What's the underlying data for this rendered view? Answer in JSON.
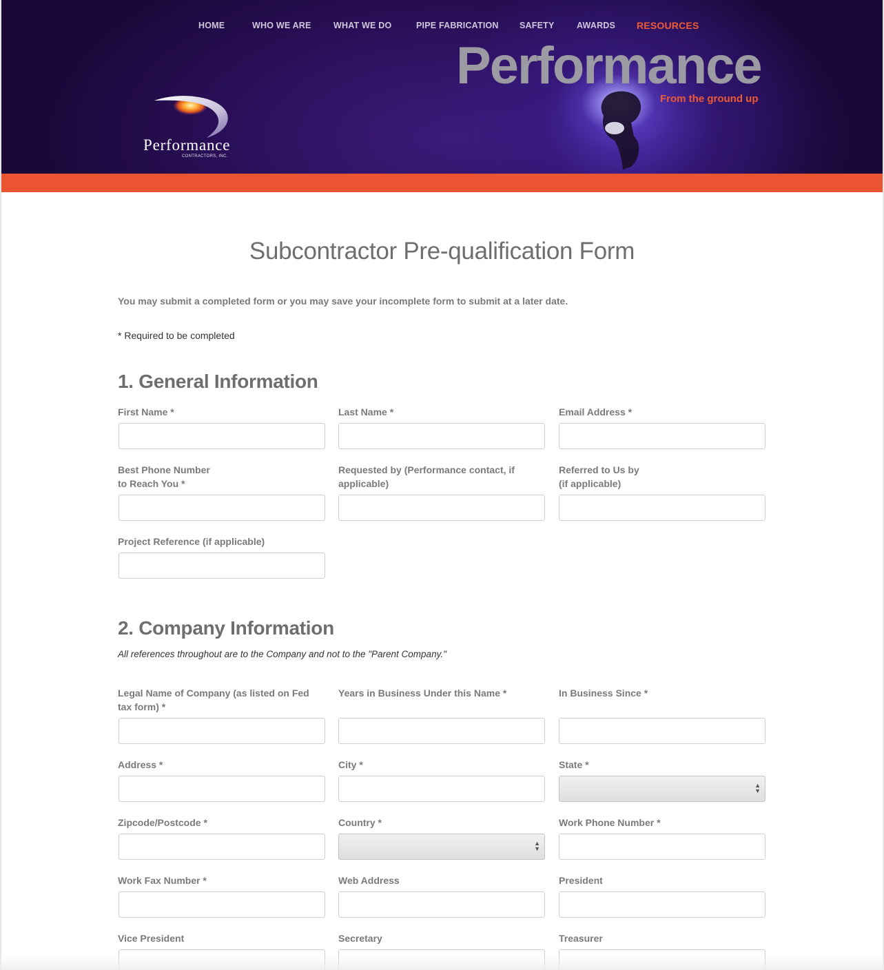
{
  "nav": {
    "items": [
      {
        "label": "HOME"
      },
      {
        "label": "WHO WE ARE"
      },
      {
        "label": "WHAT WE DO"
      },
      {
        "label": "PIPE FABRICATION"
      },
      {
        "label": "SAFETY"
      },
      {
        "label": "AWARDS"
      },
      {
        "label": "RESOURCES"
      }
    ],
    "active_color": "#ef5a32"
  },
  "header": {
    "hero_word": "Performance",
    "hero_tagline": "From the ground up",
    "logo_word": "Performance",
    "logo_sub": "CONTRACTORS, INC.",
    "accent_color": "#ea5430"
  },
  "page": {
    "title": "Subcontractor Pre-qualification Form",
    "intro": "You may submit a completed form or you may save your incomplete form to submit at a later date.",
    "required_note": "* Required to be completed"
  },
  "sections": {
    "general": {
      "title": "1. General Information",
      "fields": {
        "first_name": "First Name *",
        "last_name": "Last Name *",
        "email": "Email Address *",
        "phone_line1": "Best Phone Number",
        "phone_line2": "to Reach You *",
        "requested_by": "Requested by (Performance contact, if applicable)",
        "referred_line1": "Referred to Us by",
        "referred_line2": "(if applicable)",
        "project_reference": "Project Reference (if applicable)"
      }
    },
    "company": {
      "title": "2. Company Information",
      "note": "All references throughout are to the Company and not to the \"Parent Company.\"",
      "fields": {
        "legal_name": "Legal Name of Company (as listed on Fed tax form) *",
        "years_in_business": "Years in Business Under this Name *",
        "in_business_since": "In Business Since *",
        "address": "Address *",
        "city": "City *",
        "state": "State *",
        "zipcode": "Zipcode/Postcode *",
        "country": "Country *",
        "work_phone": "Work Phone Number *",
        "work_fax": "Work Fax Number *",
        "web_address": "Web Address",
        "president": "President",
        "vice_president": "Vice President",
        "secretary": "Secretary",
        "treasurer": "Treasurer"
      }
    }
  }
}
